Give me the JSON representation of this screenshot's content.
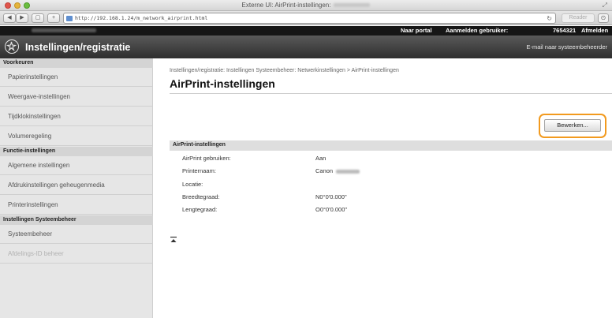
{
  "window": {
    "title": "Externe UI: AirPrint-instellingen:"
  },
  "toolbar": {
    "url": "http://192.168.1.24/m_network_airprint.html",
    "reader_label": "Reader"
  },
  "topnav": {
    "portal_label": "Naar portal",
    "logged_in_label": "Aanmelden gebruiker:",
    "user_id": "7654321",
    "logout_label": "Afmelden"
  },
  "header": {
    "title": "Instellingen/registratie",
    "mail_admin_label": "E-mail naar systeembeheerder"
  },
  "sidebar": {
    "groups": [
      {
        "heading": "Voorkeuren",
        "items": [
          "Papierinstellingen",
          "Weergave-instellingen",
          "Tijdklokinstellingen",
          "Volumeregeling"
        ]
      },
      {
        "heading": "Functie-instellingen",
        "items": [
          "Algemene instellingen",
          "Afdrukinstellingen geheugenmedia",
          "Printerinstellingen"
        ]
      },
      {
        "heading": "Instellingen Systeembeheer",
        "items": [
          "Systeembeheer",
          "Afdelings-ID beheer"
        ]
      }
    ]
  },
  "main": {
    "breadcrumb": "Instellingen/registratie: Instellingen Systeembeheer: Netwerkinstellingen > AirPrint-instellingen",
    "title": "AirPrint-instellingen",
    "edit_button": "Bewerken...",
    "section_heading": "AirPrint-instellingen",
    "rows": [
      {
        "label": "AirPrint gebruiken:",
        "value": "Aan"
      },
      {
        "label": "Printernaam:",
        "value": "Canon"
      },
      {
        "label": "Locatie:",
        "value": ""
      },
      {
        "label": "Breedtegraad:",
        "value": "N0°0'0.000\""
      },
      {
        "label": "Lengtegraad:",
        "value": "O0°0'0.000\""
      }
    ]
  },
  "colors": {
    "highlight": "#f29a1e",
    "header_bg": "#3c3c3c",
    "topbar_bg": "#161616",
    "sidebar_bg": "#e6e6e6"
  }
}
